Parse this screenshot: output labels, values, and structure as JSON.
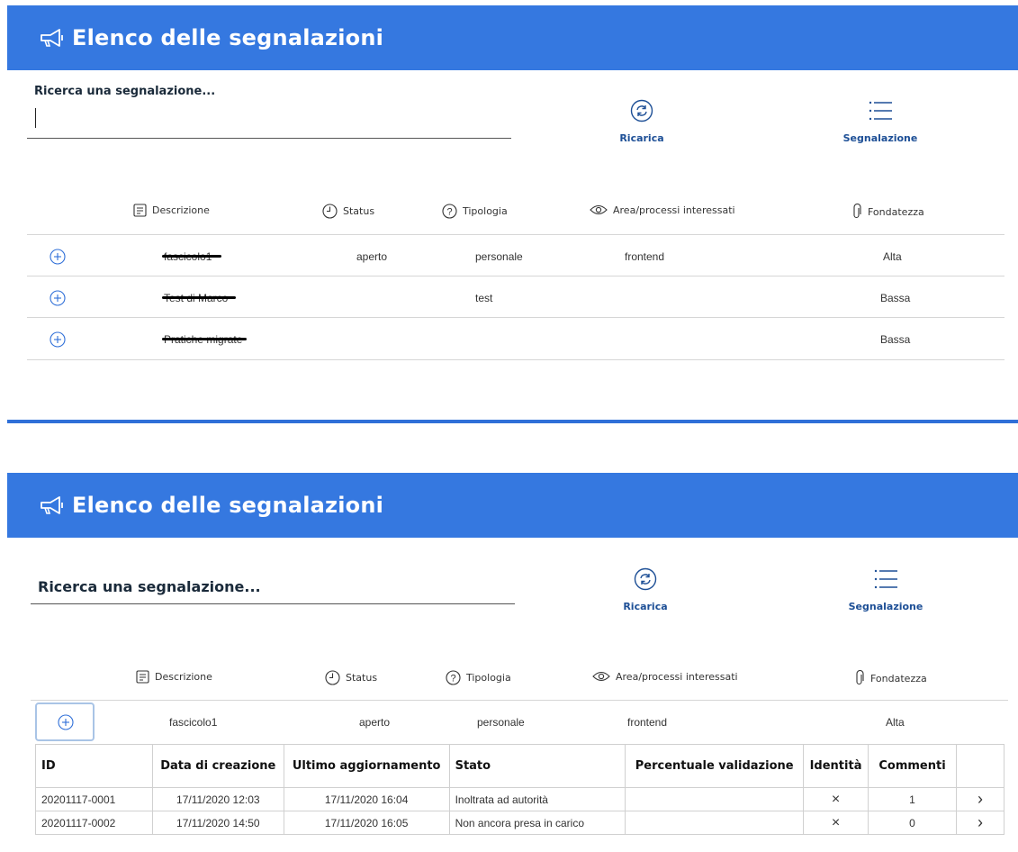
{
  "title": "Elenco delle segnalazioni",
  "search": {
    "label": "Ricerca una segnalazione...",
    "placeholder": "Ricerca una segnalazione..."
  },
  "actions": {
    "reload": "Ricarica",
    "report": "Segnalazione"
  },
  "columns": {
    "descrizione": "Descrizione",
    "status": "Status",
    "tipologia": "Tipologia",
    "area": "Area/processi interessati",
    "fondatezza": "Fondatezza"
  },
  "rows": [
    {
      "descrizione": "fascicolo1",
      "status": "aperto",
      "tipologia": "personale",
      "area": "frontend",
      "fondatezza": "Alta"
    },
    {
      "descrizione": "Test di Marco",
      "status": "",
      "tipologia": "test",
      "area": "",
      "fondatezza": "Bassa"
    },
    {
      "descrizione": "Pratiche migrate",
      "status": "",
      "tipologia": "",
      "area": "",
      "fondatezza": "Bassa"
    }
  ],
  "expanded_row": {
    "descrizione": "fascicolo1",
    "status": "aperto",
    "tipologia": "personale",
    "area": "frontend",
    "fondatezza": "Alta"
  },
  "sub_table": {
    "headers": [
      "ID",
      "Data di creazione",
      "Ultimo aggiornamento",
      "Stato",
      "Percentuale validazione",
      "Identità",
      "Commenti"
    ],
    "rows": [
      {
        "id": "20201117-0001",
        "created": "17/11/2020 12:03",
        "updated": "17/11/2020 16:04",
        "state": "Inoltrata ad autorità",
        "validation": "",
        "identity": "×",
        "comments": "1",
        "open": "›"
      },
      {
        "id": "20201117-0002",
        "created": "17/11/2020 14:50",
        "updated": "17/11/2020 16:05",
        "state": "Non ancora presa in carico",
        "validation": "",
        "identity": "×",
        "comments": "0",
        "open": "›"
      }
    ]
  },
  "colors": {
    "header": "#3578e0",
    "link": "#1d4f96",
    "danger": "#e0342c"
  }
}
